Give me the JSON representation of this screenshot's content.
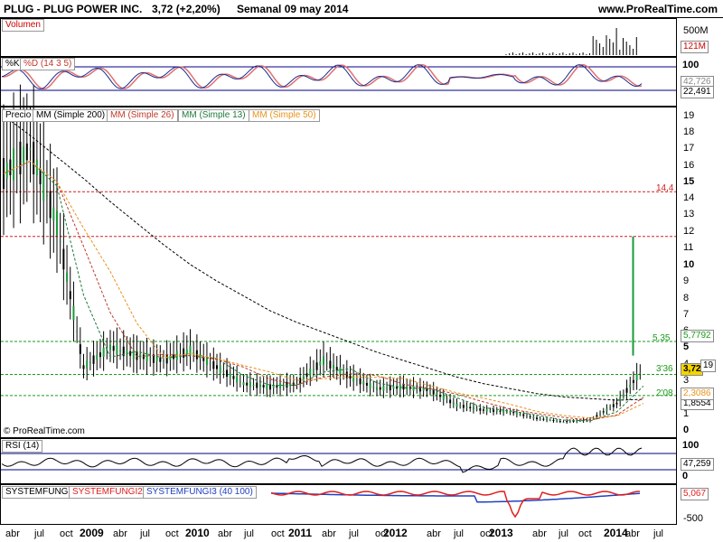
{
  "header": {
    "symbol": "PLUG - PLUG POWER INC.",
    "price_change": "3,72 (+2,20%)",
    "period": "Semanal  09 may 2014",
    "source": "www.ProRealTime.com"
  },
  "volume_panel": {
    "label": "Volumen",
    "ticks": [
      "500M"
    ],
    "value_box": "121M"
  },
  "stoch_panel": {
    "label_k": "%K",
    "label_d": "%D (14 3 5)",
    "ticks": [
      "100"
    ],
    "value_boxes": [
      "42,726",
      "22,491"
    ]
  },
  "price_panel": {
    "legend": [
      "Precio",
      "MM (Simple 200)",
      "MM (Simple 26)",
      "MM (Simple 13)",
      "MM (Simple 50)"
    ],
    "ticks": [
      "19",
      "18",
      "17",
      "16",
      "15",
      "14",
      "13",
      "12",
      "11",
      "10",
      "9",
      "8",
      "7",
      "6",
      "5",
      "4",
      "3",
      "2",
      "1",
      "0"
    ],
    "level_labels": [
      "14,4",
      "5,35",
      "3'36",
      "2'08"
    ],
    "value_boxes": [
      "5,7792",
      "3,72",
      "19",
      "1,8554",
      "2,3086"
    ],
    "copyright": "© ProRealTime.com"
  },
  "rsi_panel": {
    "label": "RSI (14)",
    "ticks": [
      "100",
      "0"
    ],
    "value_box": "47,259"
  },
  "fungi_panel": {
    "labels": [
      "SYSTEMFUNGI",
      "SYSTEMFUNGI2",
      "SYSTEMFUNGI3 (40 100)"
    ],
    "ticks": [
      "-500"
    ],
    "value_box": "5,067"
  },
  "x_axis": [
    "abr",
    "jul",
    "oct",
    "2009",
    "abr",
    "jul",
    "oct",
    "2010",
    "abr",
    "jul",
    "oct",
    "2011",
    "abr",
    "jul",
    "oct",
    "2012",
    "abr",
    "jul",
    "oct",
    "2013",
    "abr",
    "jul",
    "oct",
    "2014",
    "abr",
    "jul"
  ],
  "colors": {
    "sma200": "#000000",
    "sma26": "#c0392b",
    "sma13": "#1e7a3a",
    "sma50": "#e8921a",
    "level_red": "#d22020",
    "level_green": "#1a9a1a",
    "fungi2": "#e02020",
    "fungi3": "#2040c0"
  },
  "chart_data": {
    "type": "line",
    "title": "PLUG - PLUG POWER INC.",
    "xlabel": "",
    "ylabel": "",
    "x": [
      "2008-04",
      "2008-07",
      "2008-10",
      "2009-01",
      "2009-04",
      "2009-07",
      "2009-10",
      "2010-01",
      "2010-04",
      "2010-07",
      "2010-10",
      "2011-01",
      "2011-04",
      "2011-07",
      "2011-10",
      "2012-01",
      "2012-04",
      "2012-07",
      "2012-10",
      "2013-01",
      "2013-04",
      "2013-07",
      "2013-10",
      "2014-01",
      "2014-04"
    ],
    "series": [
      {
        "name": "Precio",
        "values": [
          15.5,
          17.0,
          12.5,
          3.8,
          5.0,
          4.5,
          4.2,
          4.8,
          3.8,
          2.8,
          2.6,
          2.8,
          4.2,
          3.2,
          2.5,
          2.6,
          2.4,
          1.5,
          1.2,
          1.1,
          0.7,
          0.5,
          0.6,
          1.6,
          3.72
        ]
      },
      {
        "name": "MM (Simple 200)",
        "values": [
          19.0,
          17.8,
          16.5,
          15.2,
          13.8,
          12.5,
          11.2,
          10.0,
          9.0,
          8.1,
          7.2,
          6.5,
          5.9,
          5.3,
          4.7,
          4.2,
          3.7,
          3.2,
          2.8,
          2.5,
          2.2,
          2.0,
          1.9,
          1.8,
          1.85
        ]
      }
    ],
    "ylim": [
      0,
      19
    ],
    "levels": [
      14.4,
      5.35,
      3.36,
      2.08
    ]
  }
}
